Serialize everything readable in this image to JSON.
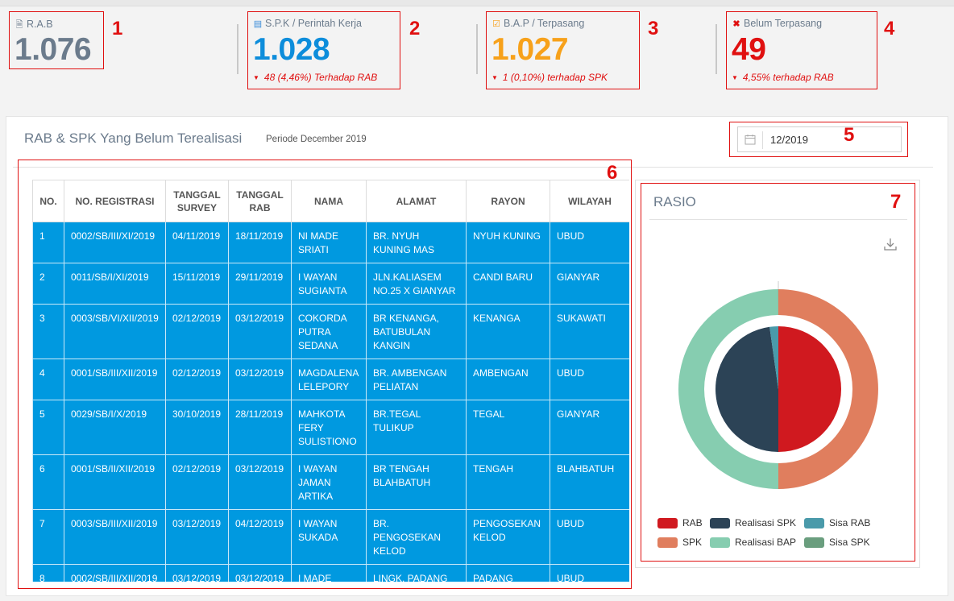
{
  "stats": [
    {
      "label": "R.A.B",
      "icon": "document-icon",
      "value": "1.076",
      "color": "#6b7b8c",
      "sub": "",
      "tag": "1"
    },
    {
      "label": "S.P.K / Perintah Kerja",
      "icon": "list-icon",
      "value": "1.028",
      "color": "#0d8ddb",
      "sub": "48 (4,46%) Terhadap RAB",
      "tag": "2"
    },
    {
      "label": "B.A.P / Terpasang",
      "icon": "check-square-icon",
      "value": "1.027",
      "color": "#f7a11a",
      "sub": "1 (0,10%) terhadap SPK",
      "tag": "3"
    },
    {
      "label": "Belum Terpasang",
      "icon": "x-icon",
      "value": "49",
      "color": "#e01010",
      "sub": "4,55% terhadap RAB",
      "tag": "4"
    }
  ],
  "panel": {
    "title": "RAB & SPK Yang Belum Terealisasi",
    "period": "Periode December 2019",
    "date_value": "12/2019",
    "date_tag": "5",
    "table_tag": "6"
  },
  "table": {
    "headers": [
      "NO.",
      "NO. REGISTRASI",
      "TANGGAL SURVEY",
      "TANGGAL RAB",
      "NAMA",
      "ALAMAT",
      "RAYON",
      "WILAYAH"
    ],
    "rows": [
      [
        "1",
        "0002/SB/III/XI/2019",
        "04/11/2019",
        "18/11/2019",
        "NI MADE SRIATI",
        "BR. NYUH KUNING MAS",
        "NYUH KUNING",
        "UBUD"
      ],
      [
        "2",
        "0011/SB/I/XI/2019",
        "15/11/2019",
        "29/11/2019",
        "I WAYAN SUGIANTA",
        "JLN.KALIASEM NO.25 X GIANYAR",
        "CANDI BARU",
        "GIANYAR"
      ],
      [
        "3",
        "0003/SB/VI/XII/2019",
        "02/12/2019",
        "03/12/2019",
        "COKORDA PUTRA SEDANA",
        "BR KENANGA, BATUBULAN KANGIN",
        "KENANGA",
        "SUKAWATI"
      ],
      [
        "4",
        "0001/SB/III/XII/2019",
        "02/12/2019",
        "03/12/2019",
        "MAGDALENA LELEPORY",
        "BR. AMBENGAN PELIATAN",
        "AMBENGAN",
        "UBUD"
      ],
      [
        "5",
        "0029/SB/I/X/2019",
        "30/10/2019",
        "28/11/2019",
        "MAHKOTA FERY SULISTIONO",
        "BR.TEGAL TULIKUP",
        "TEGAL",
        "GIANYAR"
      ],
      [
        "6",
        "0001/SB/II/XII/2019",
        "02/12/2019",
        "03/12/2019",
        "I WAYAN JAMAN ARTIKA",
        "BR TENGAH BLAHBATUH",
        "TENGAH",
        "BLAHBATUH"
      ],
      [
        "7",
        "0003/SB/III/XII/2019",
        "03/12/2019",
        "04/12/2019",
        "I WAYAN SUKADA",
        "BR. PENGOSEKAN KELOD",
        "PENGOSEKAN KELOD",
        "UBUD"
      ],
      [
        "8",
        "0002/SB/III/XII/2019",
        "03/12/2019",
        "03/12/2019",
        "I MADE",
        "LINGK. PADANG",
        "PADANG",
        "UBUD"
      ]
    ]
  },
  "chart": {
    "title": "RASIO",
    "tag": "7",
    "download_icon": "download-icon"
  },
  "chart_data": {
    "type": "pie",
    "inner": [
      {
        "name": "RAB",
        "value": 1076,
        "color": "#d0191f"
      },
      {
        "name": "Realisasi SPK",
        "value": 1028,
        "color": "#2c4356"
      },
      {
        "name": "Sisa RAB",
        "value": 48,
        "color": "#4a9aaa"
      }
    ],
    "outer": [
      {
        "name": "SPK",
        "value": 1028,
        "color": "#e07e5e"
      },
      {
        "name": "Realisasi BAP",
        "value": 1027,
        "color": "#86cdb0"
      },
      {
        "name": "Sisa SPK",
        "value": 1,
        "color": "#6a9e7e"
      }
    ],
    "legend": [
      "RAB",
      "Realisasi SPK",
      "Sisa RAB",
      "SPK",
      "Realisasi BAP",
      "Sisa SPK"
    ],
    "legend_position": "bottom"
  }
}
